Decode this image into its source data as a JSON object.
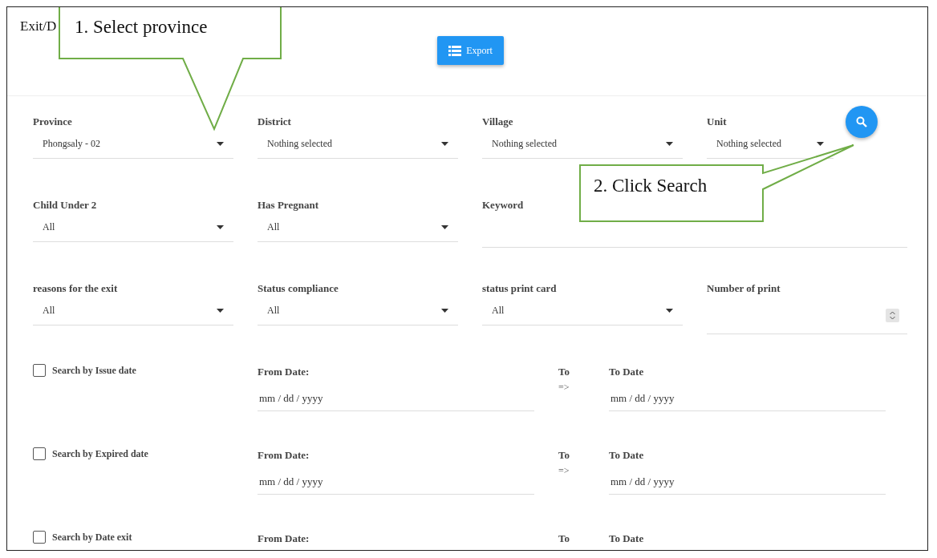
{
  "header": {
    "title": "Exit/D",
    "export_button": "Export"
  },
  "filter_rows": [
    [
      {
        "kind": "select",
        "label": "Province",
        "value": "Phongsaly - 02"
      },
      {
        "kind": "select",
        "label": "District",
        "value": "Nothing selected"
      },
      {
        "kind": "select",
        "label": "Village",
        "value": "Nothing selected"
      },
      {
        "kind": "select",
        "label": "Unit",
        "value": "Nothing selected"
      }
    ],
    [
      {
        "kind": "select",
        "label": "Child Under 2",
        "value": "All"
      },
      {
        "kind": "select",
        "label": "Has Pregnant",
        "value": "All"
      },
      {
        "kind": "text",
        "label": "Keyword"
      }
    ],
    [
      {
        "kind": "select",
        "label": "reasons for the exit",
        "value": "All"
      },
      {
        "kind": "select",
        "label": "Status compliance",
        "value": "All"
      },
      {
        "kind": "select",
        "label": "status print card",
        "value": "All"
      },
      {
        "kind": "number",
        "label": "Number of print"
      }
    ]
  ],
  "date_ranges": [
    {
      "label": "Search by Issue date",
      "checked": false,
      "from_label": "From Date:",
      "from_placeholder": "mm / dd / yyyy",
      "to_word": "To",
      "arrow": "=>",
      "to_label": "To Date",
      "to_placeholder": "mm / dd / yyyy"
    },
    {
      "label": "Search by Expired date",
      "checked": false,
      "from_label": "From Date:",
      "from_placeholder": "mm / dd / yyyy",
      "to_word": "To",
      "arrow": "=>",
      "to_label": "To Date",
      "to_placeholder": "mm / dd / yyyy"
    },
    {
      "label": "Search by Date exit",
      "checked": false,
      "from_label": "From Date:",
      "to_word": "To",
      "to_label": "To Date"
    }
  ],
  "callouts": [
    {
      "text": "1. Select province"
    },
    {
      "text": "2. Click Search"
    }
  ]
}
